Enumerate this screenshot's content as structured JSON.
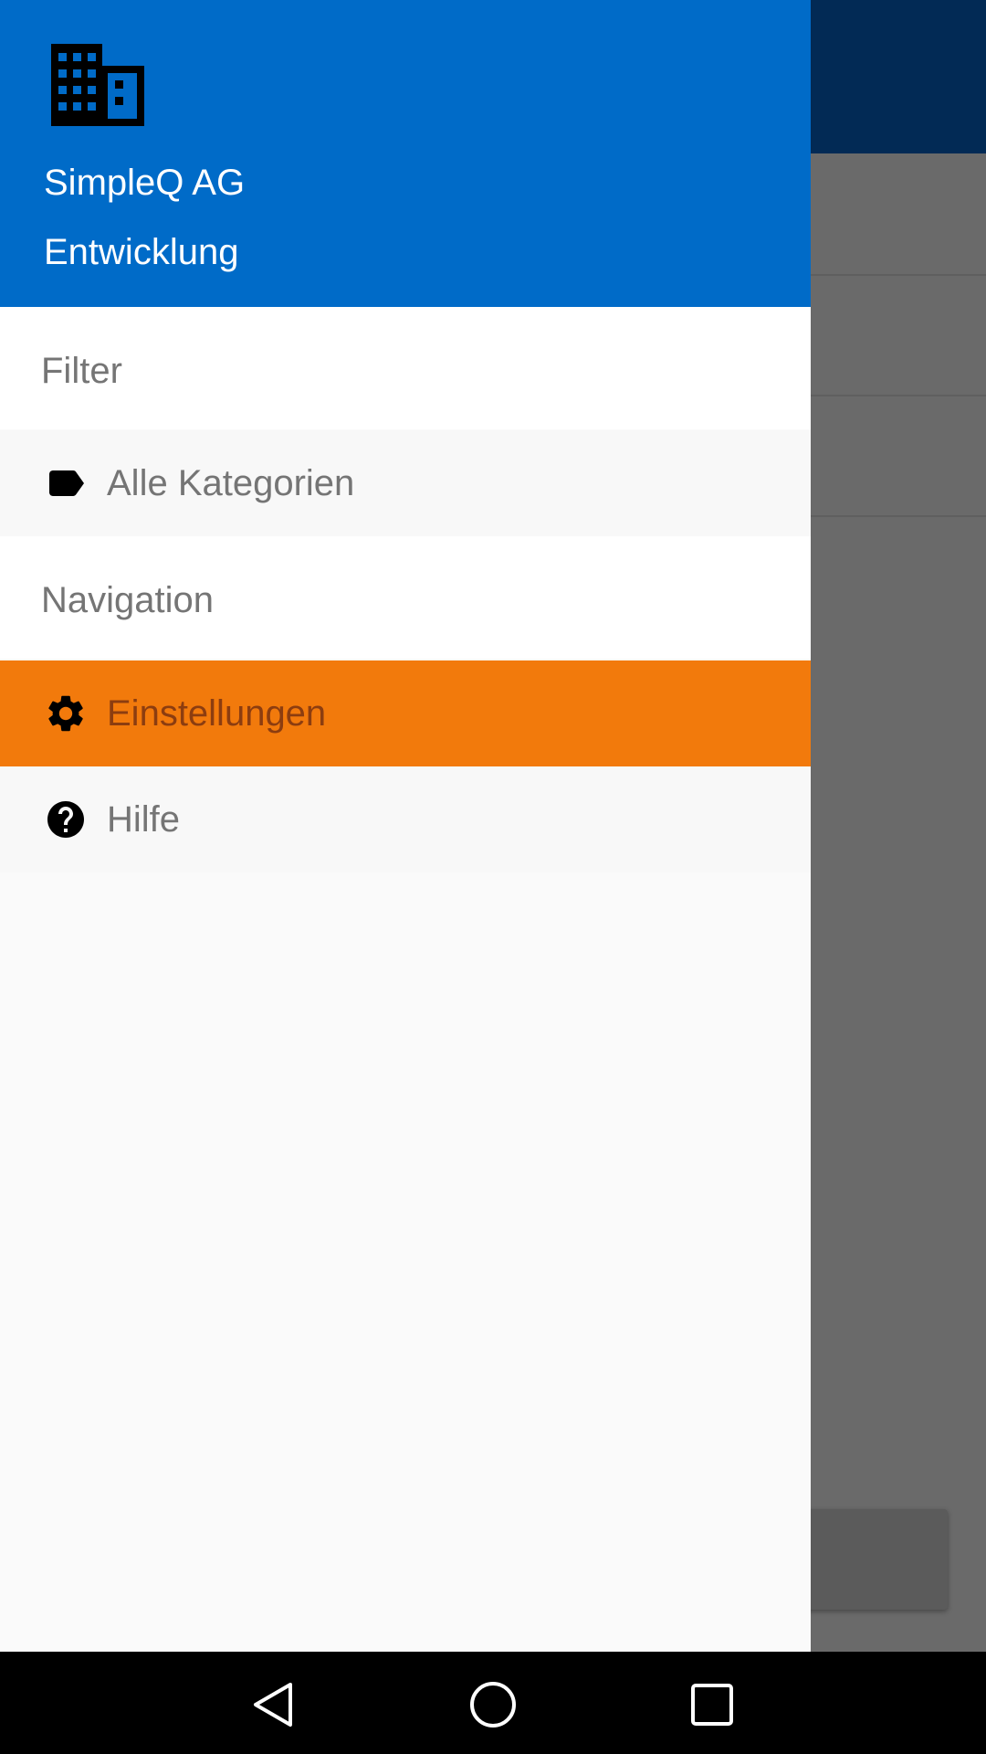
{
  "drawer": {
    "header": {
      "company_name": "SimpleQ AG",
      "department": "Entwicklung",
      "icon": "building-icon",
      "background_color": "#006bc8"
    },
    "sections": [
      {
        "title": "Filter",
        "items": [
          {
            "label": "Alle Kategorien",
            "icon": "label-tag-icon",
            "active": false
          }
        ]
      },
      {
        "title": "Navigation",
        "items": [
          {
            "label": "Einstellungen",
            "icon": "gear-icon",
            "active": true
          },
          {
            "label": "Hilfe",
            "icon": "help-circle-icon",
            "active": false
          }
        ]
      }
    ],
    "active_color": "#f27a0c"
  },
  "system_nav": {
    "buttons": [
      "back-icon",
      "home-icon",
      "recents-icon"
    ]
  }
}
